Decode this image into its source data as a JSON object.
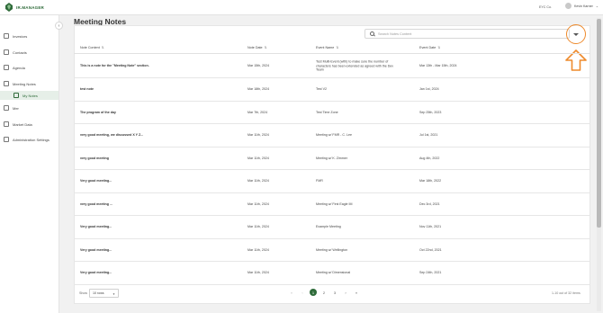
{
  "app": {
    "logo_text": "IR.MANAGER"
  },
  "header": {
    "org": "EYC Co.",
    "user_name": "Kevin Karner"
  },
  "sidebar": {
    "items": [
      {
        "label": "Investors",
        "icon": "investors-icon"
      },
      {
        "label": "Contacts",
        "icon": "contacts-icon"
      },
      {
        "label": "Agenda",
        "icon": "agenda-icon"
      },
      {
        "label": "Meeting Notes",
        "icon": "meeting-notes-icon"
      },
      {
        "label": "My Notes",
        "icon": "my-notes-icon"
      },
      {
        "label": "Mer",
        "icon": "mer-icon"
      },
      {
        "label": "Market Data",
        "icon": "market-data-icon"
      },
      {
        "label": "Administration Settings",
        "icon": "admin-settings-icon"
      }
    ]
  },
  "page": {
    "title": "Meeting Notes"
  },
  "search": {
    "placeholder": "Search Notes Content",
    "value": ""
  },
  "table": {
    "headers": [
      "Note Content",
      "Note Date",
      "Event Name",
      "Event Date"
    ],
    "rows": [
      [
        "This is a note for the \"Meeting Note\" section.",
        "Mar 15th, 2024",
        "Test Multi-Event (with) to make sure the number of characters has been extended as agreed with the Dev Team",
        "Mar 13th - Mar 15th, 2024"
      ],
      [
        "test note",
        "Mar 18th, 2024",
        "Test V2",
        "Jan 1st, 2024"
      ],
      [
        "The program of the day",
        "Mar 7th, 2024",
        "Test Time Zone",
        "Sep 25th, 2023"
      ],
      [
        "very good meeting, we discussed X Y Z...",
        "Mar 11th, 2024",
        "Meeting w/ FMR - C. Lee",
        "Jul 1st, 2021"
      ],
      [
        "very good meeting",
        "Mar 11th, 2024",
        "Meeting w/ K. Zimmer",
        "Aug 4th, 2022"
      ],
      [
        "Very good meeting...",
        "Mar 11th, 2024",
        "FMR",
        "Mar 18th, 2022"
      ],
      [
        "very good meeting ...",
        "Mar 11th, 2024",
        "Meeting w/ First Eagle IM",
        "Dec 3rd, 2021"
      ],
      [
        "Very good meeting...",
        "Mar 11th, 2024",
        "Example Meeting",
        "Nov 11th, 2021"
      ],
      [
        "Very good meeting...",
        "Mar 11th, 2024",
        "Meeting w/ Wellington",
        "Oct 22nd, 2021"
      ],
      [
        "Very good meeting...",
        "Mar 11th, 2024",
        "Meeting w/ Dimensional",
        "Sep 24th, 2021"
      ]
    ]
  },
  "footer": {
    "show_label": "Show",
    "per_page": "10 rows",
    "pages": [
      "1",
      "2",
      "3"
    ],
    "current_page": "1",
    "range_text": "1-10 out of 32 items"
  },
  "colors": {
    "brand": "#2f6b3a",
    "highlight": "#ee8a2c"
  }
}
